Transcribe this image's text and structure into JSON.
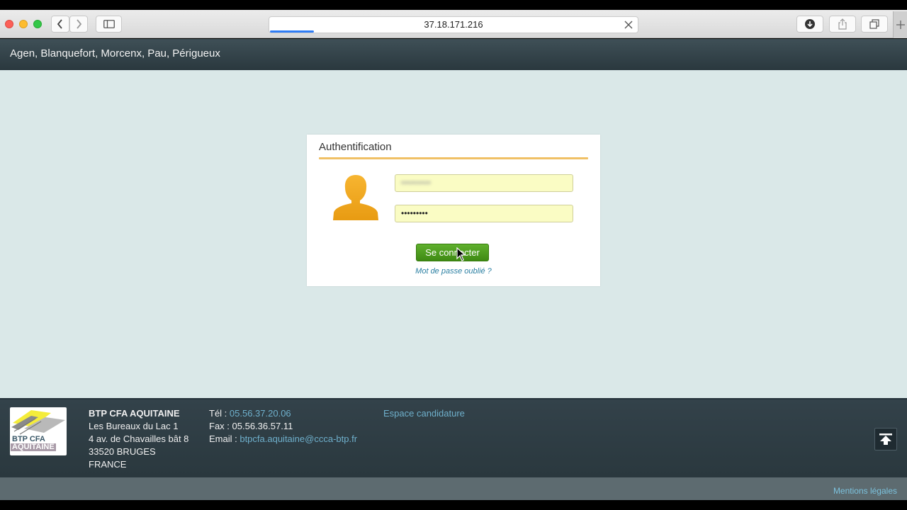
{
  "browser": {
    "url": "37.18.171.216",
    "back_icon": "chevron-left-icon",
    "forward_icon": "chevron-right-icon",
    "sidebar_icon": "sidebar-icon",
    "download_icon": "download-icon",
    "share_icon": "share-icon",
    "tabs_icon": "tabs-icon",
    "new_tab_icon": "plus-icon",
    "load_progress": 0.12
  },
  "header": {
    "cities": "Agen, Blanquefort, Morcenx, Pau, Périgueux"
  },
  "auth": {
    "title": "Authentification",
    "username_value": "••••••••••",
    "password_value": "•••••••••",
    "login_button": "Se connecter",
    "forgot_link": "Mot de passe oublié ?",
    "accent_color": "#f0c065",
    "button_color": "#4e9d1f"
  },
  "footer": {
    "logo_line1": "BTP CFA",
    "logo_line2": "AQUITAINE",
    "org_name": "BTP CFA AQUITAINE",
    "address": [
      "Les Bureaux du Lac 1",
      "4 av. de Chavailles bât 8",
      "33520 BRUGES",
      "FRANCE"
    ],
    "tel_label": "Tél : ",
    "tel_value": "05.56.37.20.06",
    "fax_label": "Fax : ",
    "fax_value": "05.56.36.57.11",
    "email_label": "Email : ",
    "email_value": "btpcfa.aquitaine@ccca-btp.fr",
    "candidate_link": "Espace candidature",
    "scroll_top_icon": "arrow-up-to-top-icon",
    "legal_link": "Mentions légales"
  }
}
